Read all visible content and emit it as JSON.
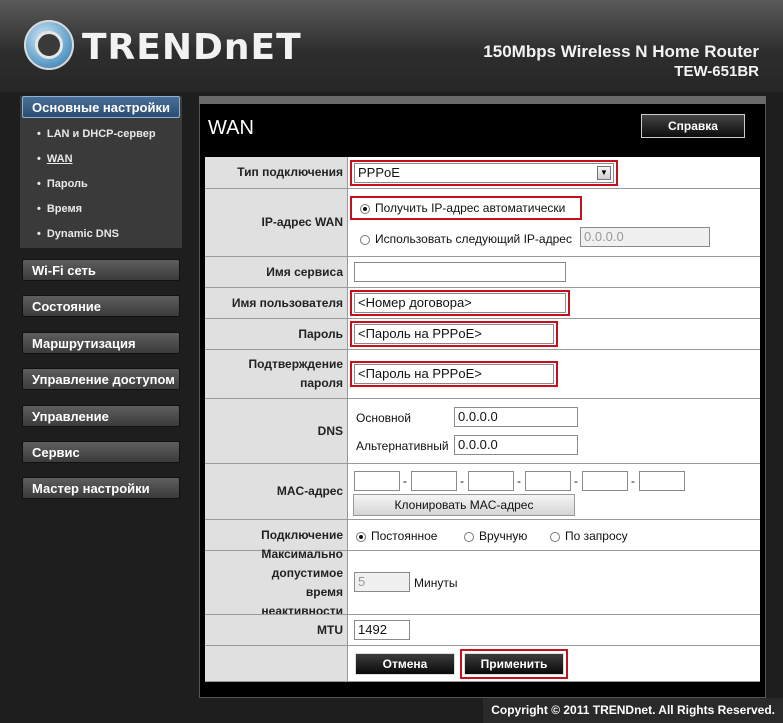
{
  "header": {
    "brand": "TRENDnET",
    "model_name": "150Mbps Wireless N Home Router",
    "model_number": "TEW-651BR"
  },
  "sidebar": {
    "sections": [
      {
        "label": "Основные настройки",
        "active": true
      },
      {
        "label": "Wi-Fi сеть"
      },
      {
        "label": "Состояние"
      },
      {
        "label": "Маршрутизация"
      },
      {
        "label": "Управление доступом"
      },
      {
        "label": "Управление"
      },
      {
        "label": "Сервис"
      },
      {
        "label": "Мастер настройки"
      }
    ],
    "subitems": [
      {
        "label": "LAN и DHCP-сервер"
      },
      {
        "label": "WAN",
        "current": true
      },
      {
        "label": "Пароль"
      },
      {
        "label": "Время"
      },
      {
        "label": "Dynamic DNS"
      }
    ]
  },
  "page": {
    "title": "WAN",
    "help_label": "Справка"
  },
  "form": {
    "connection_type": {
      "label": "Тип подключения",
      "value": "PPPoE"
    },
    "wan_ip": {
      "label": "IP-адрес WAN",
      "auto_label": "Получить IP-адрес автоматически",
      "manual_label": "Использовать следующий IP-адрес",
      "manual_value": "0.0.0.0"
    },
    "service_name": {
      "label": "Имя сервиса",
      "value": ""
    },
    "username": {
      "label": "Имя пользователя",
      "value": "<Номер договора>"
    },
    "password": {
      "label": "Пароль",
      "value": "<Пароль на PPPoE>"
    },
    "confirm_password": {
      "label": "Подтверждение пароля",
      "value": "<Пароль на PPPoE>"
    },
    "dns": {
      "label": "DNS",
      "primary_label": "Основной",
      "primary_value": "0.0.0.0",
      "secondary_label": "Альтернативный",
      "secondary_value": "0.0.0.0"
    },
    "mac": {
      "label": "MAC-адрес",
      "separator": "-",
      "clone_label": "Клонировать MAC-адрес"
    },
    "connection_mode": {
      "label": "Подключение",
      "options": [
        "Постоянное",
        "Вручную",
        "По запросу"
      ],
      "selected": "Постоянное"
    },
    "idle_time": {
      "label": "Максимально допустимое время неактивности",
      "value": "5",
      "unit": "Минуты"
    },
    "mtu": {
      "label": "MTU",
      "value": "1492"
    },
    "cancel_label": "Отмена",
    "apply_label": "Применить"
  },
  "footer": {
    "copyright": "Copyright © 2011 TRENDnet. All Rights Reserved."
  },
  "colors": {
    "highlight": "#c8101c",
    "active_section": "#2b4d73"
  }
}
